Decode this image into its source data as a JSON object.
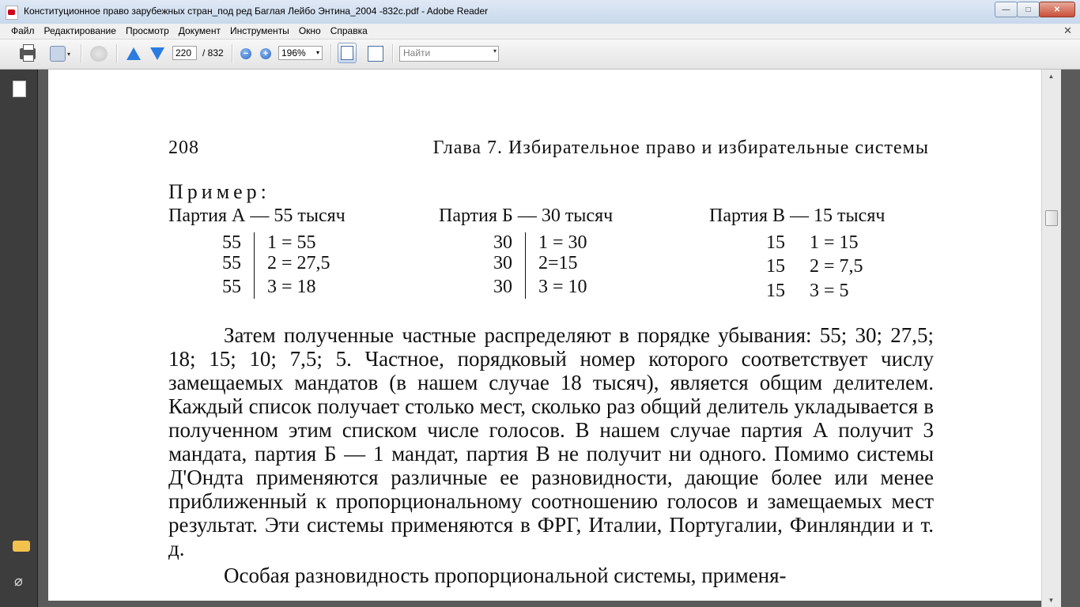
{
  "window": {
    "title": "Конституционное право зарубежных стран_под ред Баглая Лейбо Энтина_2004 -832с.pdf - Adobe Reader",
    "buttons": {
      "minimize": "—",
      "maximize": "□",
      "close": "✕"
    }
  },
  "menu": {
    "items": [
      "Файл",
      "Редактирование",
      "Просмотр",
      "Документ",
      "Инструменты",
      "Окно",
      "Справка"
    ],
    "close_doc": "✕"
  },
  "toolbar": {
    "page_current": "220",
    "page_total": "/ 832",
    "zoom_out": "−",
    "zoom_in": "+",
    "zoom_level": "196%",
    "dropdown_arrow": "▾",
    "search_placeholder": "Найти"
  },
  "icons": [
    "print-icon",
    "share-icon",
    "collaborate-icon",
    "prev-page-icon",
    "next-page-icon",
    "zoom-out-icon",
    "zoom-in-icon",
    "fit-width-icon",
    "fit-page-icon",
    "pages-panel-icon",
    "comments-icon",
    "attachments-icon"
  ],
  "colors": {
    "nav_arrow": "#2b7be0",
    "workspace": "#5a5a5a",
    "navpane": "#3d3d3d"
  },
  "nav": {
    "attach_glyph": "⌀"
  },
  "scrollbar": {
    "up": "▲",
    "down": "▼"
  },
  "document": {
    "page_number": "208",
    "chapter": "Глава 7. Избирательное право и избирательные системы",
    "example_label": "Пример:",
    "parties": [
      {
        "name": "Партия А — 55 тысяч",
        "rows": [
          {
            "votes": "55",
            "division": "1 = 55"
          },
          {
            "votes": "55",
            "division": "2 = 27,5"
          },
          {
            "votes": "55",
            "division": "3 = 18"
          }
        ]
      },
      {
        "name": "Партия Б — 30 тысяч",
        "rows": [
          {
            "votes": "30",
            "division": "1 = 30"
          },
          {
            "votes": "30",
            "division": "2=15"
          },
          {
            "votes": "30",
            "division": "3 = 10"
          }
        ]
      },
      {
        "name": "Партия В — 15 тысяч",
        "rows": [
          {
            "votes": "15",
            "division": "1 = 15"
          },
          {
            "votes": "15",
            "division": "2 = 7,5"
          },
          {
            "votes": "15",
            "division": "3 = 5"
          }
        ]
      }
    ],
    "paragraph_1": "Затем полученные частные распределяют в порядке убывания: 55; 30; 27,5; 18; 15; 10; 7,5; 5. Частное, порядковый номер которого соответствует числу замещаемых мандатов (в нашем случае 18 тысяч), является общим делителем. Каждый список получает столько мест, сколько раз общий делитель укладывается в полученном этим списком числе голосов. В нашем случае партия А получит 3 мандата, партия Б — 1 мандат, партия В не получит ни одного. Помимо системы Д'Ондта применяются различные ее разновидности, дающие более или менее приближенный к пропорциональному соотношению голосов и замещаемых мест результат. Эти системы применяются в ФРГ, Италии, Португалии, Финляндии и т. д.",
    "paragraph_2_partial": "Особая разновидность пропорциональной системы, применя-"
  }
}
